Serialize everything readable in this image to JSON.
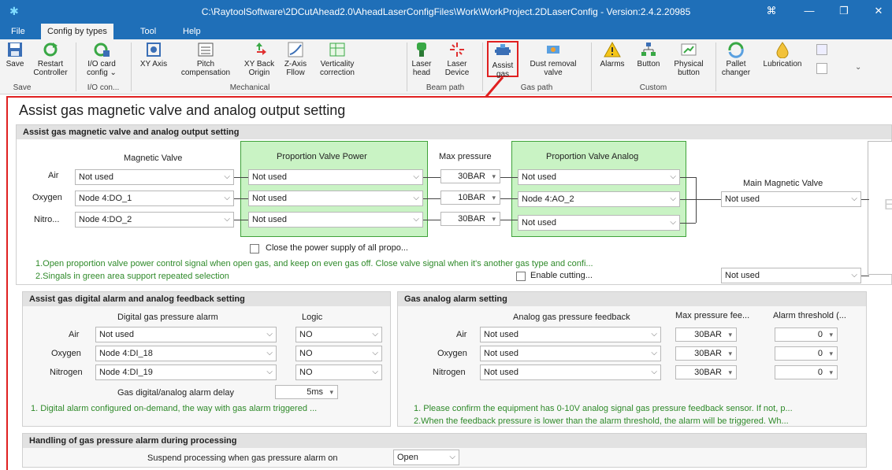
{
  "window": {
    "title": "C:\\RaytoolSoftware\\2DCutAhead2.0\\AheadLaserConfigFiles\\Work\\WorkProject.2DLaserConfig - Version:2.4.2.20985",
    "controls": [
      "⌘",
      "—",
      "❐",
      "✕"
    ]
  },
  "menu": [
    "File",
    "Config by types",
    "Tool",
    "Help"
  ],
  "ribbon": {
    "buttons": {
      "save": "Save",
      "restart": [
        "Restart",
        "Controller"
      ],
      "io": [
        "I/O card",
        "config ⌄"
      ],
      "xy": "XY Axis",
      "pitch": [
        "Pitch",
        "compensation"
      ],
      "xyback": [
        "XY Back",
        "Origin"
      ],
      "zaxis": [
        "Z-Axis",
        "Fllow"
      ],
      "vert": [
        "Verticality",
        "correction"
      ],
      "laserhead": [
        "Laser",
        "head"
      ],
      "laserdevice": [
        "Laser",
        "Device"
      ],
      "assist": [
        "Assist",
        "gas"
      ],
      "dust": [
        "Dust removal",
        "valve"
      ],
      "alarms": "Alarms",
      "button": "Button",
      "physical": [
        "Physical",
        "button"
      ],
      "pallet": [
        "Pallet",
        "changer"
      ],
      "lubrication": "Lubrication"
    },
    "groups": {
      "save": "Save",
      "io": "I/O con...",
      "mech": "Mechanical",
      "beam": "Beam path",
      "gas": "Gas path",
      "custom": "Custom"
    }
  },
  "page_title": "Assist gas magnetic valve and analog output setting",
  "sec1": {
    "header": "Assist gas magnetic valve and analog output setting",
    "col_magnetic": "Magnetic Valve",
    "col_ppower": "Proportion Valve Power",
    "col_maxp": "Max pressure",
    "col_panalog": "Proportion Valve Analog",
    "col_main": "Main Magnetic Valve",
    "rows": [
      {
        "label": "Air",
        "magnetic": "Not used",
        "power": "Not used",
        "maxp": "30BAR",
        "analog": "Not used"
      },
      {
        "label": "Oxygen",
        "magnetic": "Node 4:DO_1",
        "power": "Not used",
        "maxp": "10BAR",
        "analog": "Node 4:AO_2"
      },
      {
        "label": "Nitro...",
        "magnetic": "Node 4:DO_2",
        "power": "Not used",
        "maxp": "30BAR",
        "analog": "Not used"
      }
    ],
    "main_valve": "Not used",
    "close_power": "Close the power supply of all propo...",
    "note1": "1.Open proportion valve power control signal when open gas, and keep on even gas off. Close valve signal when it's another gas type and confi...",
    "note2": "2.Singals in green area support repeated selection",
    "enable_cutting": "Enable cutting...",
    "enable_cutting_value": "Not used",
    "right_cut_letter": "E"
  },
  "sec2": {
    "header": "Assist gas digital alarm and analog feedback setting",
    "col_digital": "Digital gas pressure alarm",
    "col_logic": "Logic",
    "rows": [
      {
        "label": "Air",
        "value": "Not used",
        "logic": "NO"
      },
      {
        "label": "Oxygen",
        "value": "Node 4:DI_18",
        "logic": "NO"
      },
      {
        "label": "Nitrogen",
        "value": "Node 4:DI_19",
        "logic": "NO"
      }
    ],
    "delay_label": "Gas digital/analog alarm delay",
    "delay_value": "5ms",
    "note": "1. Digital alarm configured on-demand, the way with gas alarm triggered ..."
  },
  "sec3": {
    "header": "Gas analog alarm setting",
    "col_feedback": "Analog gas pressure feedback",
    "col_maxp": "Max pressure fee...",
    "col_threshold": "Alarm threshold (...",
    "rows": [
      {
        "label": "Air",
        "value": "Not used",
        "maxp": "30BAR",
        "threshold": "0"
      },
      {
        "label": "Oxygen",
        "value": "Not used",
        "maxp": "30BAR",
        "threshold": "0"
      },
      {
        "label": "Nitrogen",
        "value": "Not used",
        "maxp": "30BAR",
        "threshold": "0"
      }
    ],
    "note1": "1. Please confirm the equipment has 0-10V analog signal gas pressure feedback sensor. If not, p...",
    "note2": "2.When the feedback pressure is lower than the alarm threshold, the alarm will be triggered. Wh..."
  },
  "sec4": {
    "header": "Handling of gas pressure alarm during processing",
    "label": "Suspend processing when gas pressure alarm on",
    "value": "Open"
  },
  "colors": {
    "titlebar": "#1f6fb8",
    "accent_red": "#e02020",
    "green_area": "#c9f3c4",
    "note_green": "#2f8a2a"
  }
}
